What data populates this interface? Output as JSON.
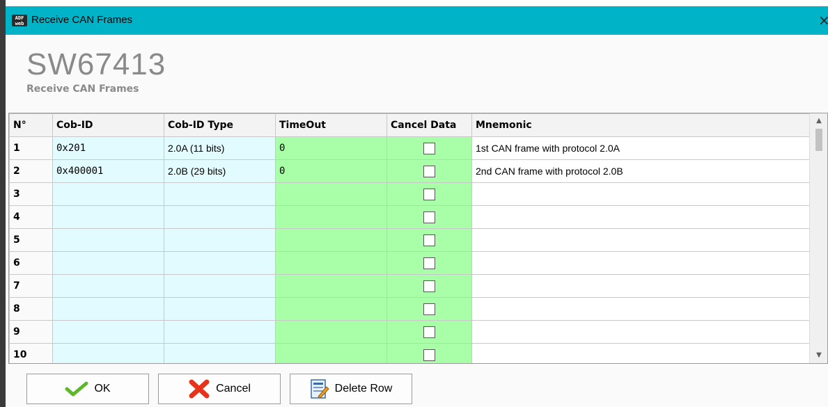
{
  "window": {
    "title": "Receive CAN Frames",
    "app_icon": "adfweb-icon",
    "icon_text_top": "ADF",
    "icon_text_bottom": "web",
    "close_glyph": "×"
  },
  "header": {
    "product_code": "SW67413",
    "subtitle": "Receive CAN Frames"
  },
  "grid": {
    "columns": [
      "N°",
      "Cob-ID",
      "Cob-ID Type",
      "TimeOut",
      "Cancel Data",
      "Mnemonic"
    ],
    "rows": [
      {
        "num": "1",
        "cob_id": "0x201",
        "cob_id_type": "2.0A (11 bits)",
        "timeout": "0",
        "cancel_data": false,
        "mnemonic": "1st CAN frame with protocol 2.0A"
      },
      {
        "num": "2",
        "cob_id": "0x400001",
        "cob_id_type": "2.0B (29 bits)",
        "timeout": "0",
        "cancel_data": false,
        "mnemonic": "2nd CAN frame with protocol 2.0B"
      },
      {
        "num": "3",
        "cob_id": "",
        "cob_id_type": "",
        "timeout": "",
        "cancel_data": false,
        "mnemonic": ""
      },
      {
        "num": "4",
        "cob_id": "",
        "cob_id_type": "",
        "timeout": "",
        "cancel_data": false,
        "mnemonic": ""
      },
      {
        "num": "5",
        "cob_id": "",
        "cob_id_type": "",
        "timeout": "",
        "cancel_data": false,
        "mnemonic": ""
      },
      {
        "num": "6",
        "cob_id": "",
        "cob_id_type": "",
        "timeout": "",
        "cancel_data": false,
        "mnemonic": ""
      },
      {
        "num": "7",
        "cob_id": "",
        "cob_id_type": "",
        "timeout": "",
        "cancel_data": false,
        "mnemonic": ""
      },
      {
        "num": "8",
        "cob_id": "",
        "cob_id_type": "",
        "timeout": "",
        "cancel_data": false,
        "mnemonic": ""
      },
      {
        "num": "9",
        "cob_id": "",
        "cob_id_type": "",
        "timeout": "",
        "cancel_data": false,
        "mnemonic": ""
      },
      {
        "num": "10",
        "cob_id": "",
        "cob_id_type": "",
        "timeout": "",
        "cancel_data": false,
        "mnemonic": ""
      }
    ]
  },
  "buttons": {
    "ok_label": "OK",
    "ok_icon": "check-icon",
    "cancel_label": "Cancel",
    "cancel_icon": "red-x-icon",
    "delete_label": "Delete Row",
    "delete_icon": "delete-row-icon"
  },
  "colors": {
    "titlebar": "#00b3c7",
    "blue_cell": "#e2fbff",
    "green_cell": "#a8ffa8",
    "product_code": "#8a8a8a"
  }
}
